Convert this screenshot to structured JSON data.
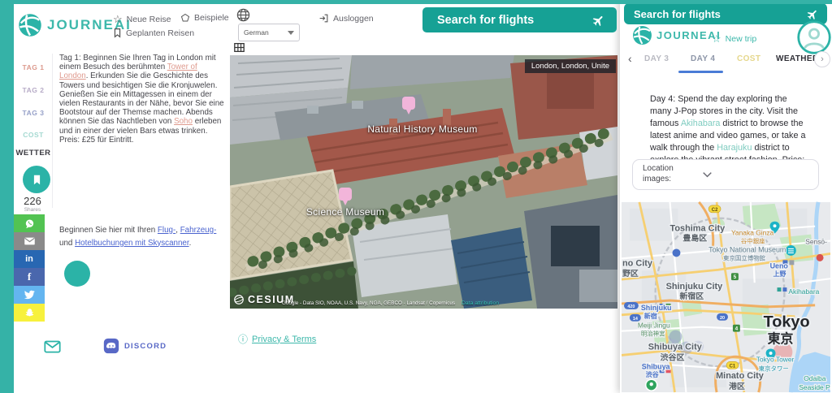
{
  "brand": {
    "teal": "#16a195",
    "teal_light": "#3db8ab",
    "active_underline": "#4a7cd6"
  },
  "icons": {
    "star": "☆",
    "chevron_left": "‹",
    "chevron_right": "›",
    "info": "ⓘ"
  },
  "header": {
    "logo_text": "JOURNEAI",
    "nav": {
      "new_trip": "Neue Reise",
      "examples": "Beispiele",
      "planned_trips": "Geplanten Reisen",
      "logout": "Ausloggen"
    },
    "language_selected": "German",
    "search_flights_button": "Search for flights"
  },
  "sidebar": {
    "tabs": [
      {
        "label": "TAG 1",
        "color": "#dc9a8e"
      },
      {
        "label": "TAG 2",
        "color": "#b7abc7"
      },
      {
        "label": "TAG 3",
        "color": "#96a0c8"
      },
      {
        "label": "COST",
        "color": "#a5d9d1"
      },
      {
        "label": "WETTER",
        "color": "#3b3b42"
      }
    ],
    "share_count": "226",
    "share_count_label": "Shares",
    "share_buttons": [
      {
        "name": "whatsapp",
        "color": "#52c352"
      },
      {
        "name": "email",
        "color": "#8a8a8a"
      },
      {
        "name": "linkedin",
        "color": "#2867b2",
        "glyph": "in"
      },
      {
        "name": "facebook",
        "color": "#4a67ad",
        "glyph": "f"
      },
      {
        "name": "twitter",
        "color": "#64b5f0"
      },
      {
        "name": "snapchat",
        "color": "#f7f13d"
      }
    ]
  },
  "itinerary": {
    "day1": {
      "t1": "Tag 1: Beginnen Sie Ihren Tag in London mit einem Besuch des berühmten ",
      "link1": "Tower of London",
      "t2": ". Erkunden Sie die Geschichte des Towers und besichtigen Sie die Kronjuwelen. Genießen Sie ein Mittagessen in einem der vielen Restaurants in der Nähe, bevor Sie eine Bootstour auf der Themse machen. Abends können Sie das Nachtleben von ",
      "link2": "Soho",
      "t3": " erleben und in einer der vielen Bars etwas trinken. Preis: £25 für Eintritt."
    },
    "booking": {
      "t1": "Beginnen Sie hier mit Ihren ",
      "link1": "Flug-",
      "t2": ", ",
      "link2": "Fahrzeug-",
      "t3": " und ",
      "link3": "Hotelbuchungen mit Skyscanner",
      "t4": "."
    }
  },
  "london_map": {
    "location_badge": "London, London, Unite",
    "pin1_label": "Natural History Museum",
    "pin2_label": "Science Museum",
    "cesium": "CESIUM",
    "attribution": "Google - Data SIO, NOAA, U.S. Navy, NGA, GEBCO - Landsat / Copernicus",
    "data_attribution": "Data attribution"
  },
  "footer": {
    "privacy_link": "Privacy & Terms",
    "discord_label": "DISCORD"
  },
  "panel": {
    "header_title": "Search for flights",
    "logo_text": "JOURNEAI",
    "new_trip_label": "New trip",
    "tabs": [
      {
        "label": "DAY 3",
        "color": "#b9bac2",
        "active": false
      },
      {
        "label": "DAY 4",
        "color": "#8d96a8",
        "active": true
      },
      {
        "label": "COST",
        "color": "#e5d78c",
        "active": false
      },
      {
        "label": "WEATHER",
        "color": "#2f2f36",
        "active": false
      }
    ],
    "day4": {
      "t1": "Day 4: Spend the day exploring the many J-Pop stores in the city. Visit the famous ",
      "link1": "Akihabara",
      "t2": " district to browse the latest anime and video games, or take a walk through the ",
      "link2": "Harajuku",
      "t3": " district to explore the vibrant street fashion. Price: free"
    },
    "location_images_label": "Location images:"
  },
  "tokyo_map": {
    "labels": {
      "toshima_en": "Toshima City",
      "toshima_jp": "豊島区",
      "shinjuku_city_en": "Shinjuku City",
      "shinjuku_city_jp": "新宿区",
      "shibuya_city_en": "Shibuya City",
      "shibuya_city_jp": "渋谷区",
      "minato_en": "Minato City",
      "minato_jp": "港区",
      "nakano_partial_en": "no City",
      "nakano_partial_jp": "野区",
      "tokyo_en": "Tokyo",
      "tokyo_jp": "東京",
      "yanaka_en": "Yanaka Ginza",
      "yanaka_jp": "谷中銀座",
      "museum_en": "Tokyo National Museum",
      "museum_jp": "東京国立博物館",
      "senso_en": "Sensō-",
      "akihabara": "Akihabara",
      "meiji_en": "Meiji Jingu",
      "meiji_jp": "明治神宮",
      "tower_en": "Tokyo Tower",
      "tower_jp": "東京タワー",
      "odaiba_l1": "Odaiba",
      "odaiba_l2": "Seaside Park",
      "ueno_en": "Ueno",
      "ueno_jp": "上野",
      "shinjuku_st_en": "Shinjuku",
      "shinjuku_st_jp": "新宿",
      "shibuya_st_en": "Shibuya",
      "shibuya_st_jp": "渋谷"
    },
    "road_shields": {
      "c2": "C2",
      "r5": "5",
      "r4": "4",
      "c1": "C1",
      "r420": "420",
      "r14": "14",
      "r20": "20"
    }
  }
}
